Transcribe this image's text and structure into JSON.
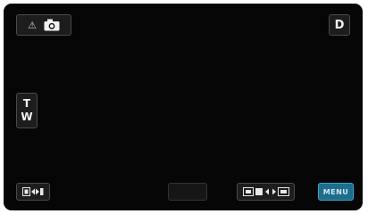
{
  "top_bar": {
    "mode_button": {
      "auto_icon": "auto-mode-icon",
      "still_icon": "still-camera-icon",
      "auto_glyph": "⚠"
    },
    "display_button": {
      "label": "D"
    }
  },
  "zoom": {
    "tele_label": "T",
    "wide_label": "W"
  },
  "bottom_bar": {
    "playback_icon": "playback-icon",
    "blank_button": "",
    "record_switch_icon": "record-mode-switch-icon",
    "menu_label": "MENU"
  },
  "colors": {
    "menu_accent": "#1e6d8a",
    "screen": "#060606"
  }
}
